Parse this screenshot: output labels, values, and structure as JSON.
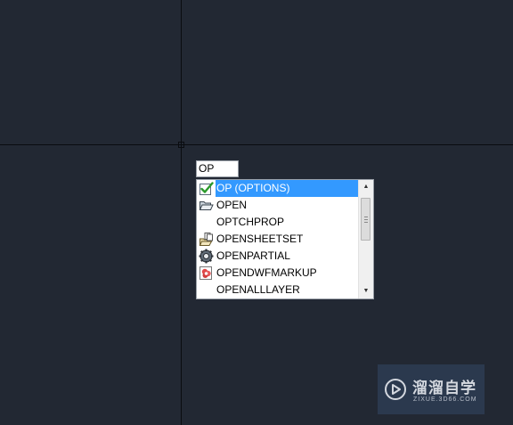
{
  "command_line": {
    "input_value": "OP"
  },
  "autocomplete": {
    "items": [
      {
        "label": "OP (OPTIONS)",
        "icon": "options-check-icon",
        "selected": true
      },
      {
        "label": "OPEN",
        "icon": "open-folder-icon",
        "selected": false
      },
      {
        "label": "OPTCHPROP",
        "icon": "",
        "selected": false
      },
      {
        "label": "OPENSHEETSET",
        "icon": "sheetset-icon",
        "selected": false
      },
      {
        "label": "OPENPARTIAL",
        "icon": "gear-icon",
        "selected": false
      },
      {
        "label": "OPENDWFMARKUP",
        "icon": "dwf-markup-icon",
        "selected": false
      },
      {
        "label": "OPENALLLAYER",
        "icon": "",
        "selected": false
      }
    ],
    "selection_color": "#3399ff"
  },
  "canvas": {
    "background_color": "#222833"
  },
  "watermark": {
    "title": "溜溜自学",
    "url": "ZIXUE.3D66.COM"
  }
}
